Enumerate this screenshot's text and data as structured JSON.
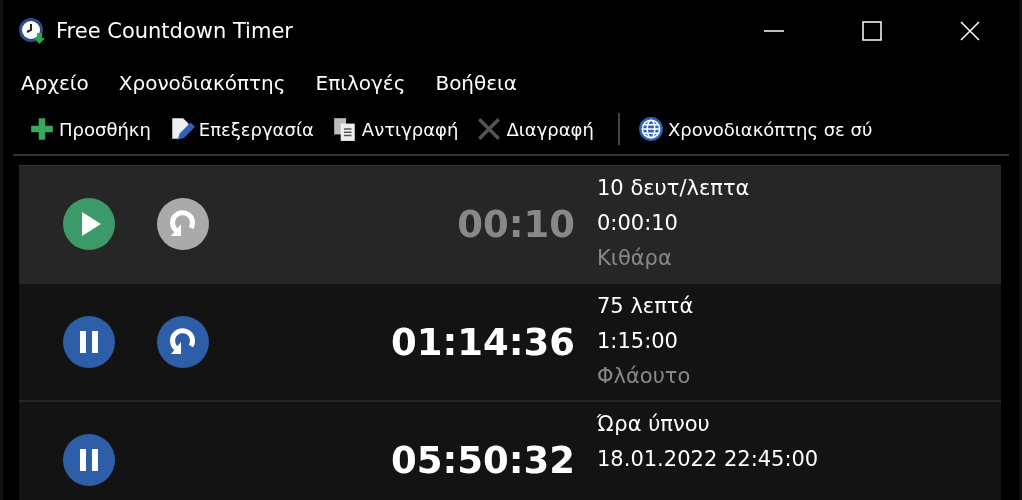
{
  "window": {
    "title": "Free Countdown Timer"
  },
  "menu": [
    "Αρχείο",
    "Χρονοδιακόπτης",
    "Επιλογές",
    "Βοήθεια"
  ],
  "toolbar": [
    {
      "kind": "add",
      "label": "Προσθήκη"
    },
    {
      "kind": "edit",
      "label": "Επεξεργασία"
    },
    {
      "kind": "copy",
      "label": "Αντιγραφή"
    },
    {
      "kind": "delete",
      "label": "Διαγραφή"
    },
    {
      "kind": "separator"
    },
    {
      "kind": "online",
      "label": "Χρονοδιακόπτης σε σύ"
    }
  ],
  "timers": [
    {
      "selected": true,
      "running": false,
      "repeat": true,
      "time": "00:10",
      "name": "10 δευτ/λεπτα",
      "target": "0:00:10",
      "sound": "Κιθάρα"
    },
    {
      "selected": false,
      "running": true,
      "repeat": true,
      "time": "01:14:36",
      "name": "75 λεπτά",
      "target": "1:15:00",
      "sound": "Φλάουτο"
    },
    {
      "selected": false,
      "running": true,
      "repeat": false,
      "time": "05:50:32",
      "name": "Ώρα ύπνου",
      "target": "18.01.2022 22:45:00"
    }
  ]
}
